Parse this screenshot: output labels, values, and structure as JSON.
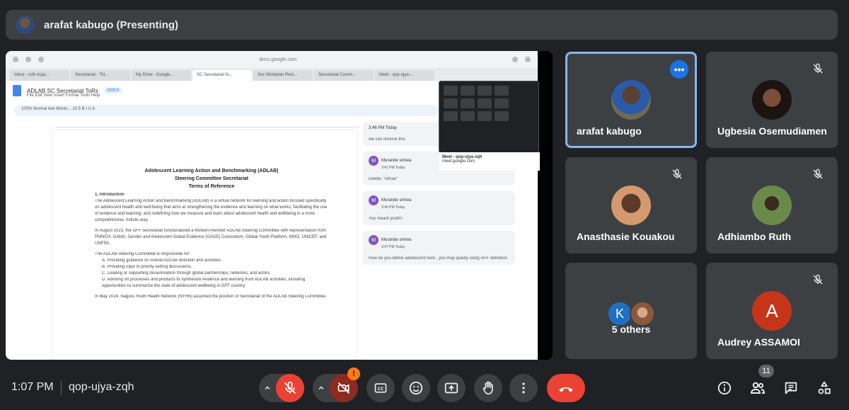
{
  "presenting": {
    "label": "arafat kabugo (Presenting)"
  },
  "screen": {
    "url": "docs.google.com",
    "tabs": [
      "Inbox - ruth.orga...",
      "Secretariat - TN...",
      "My Drive - Google...",
      "SC Secretariat fo...",
      "Sec Workplan Revi...",
      "Secretariat Comm...",
      "Meet - qop-ujya-..."
    ],
    "doc_title": "ADLAB SC Secretariat ToRs",
    "doc_badge": ".DOCX",
    "menu": "File   Edit   View   Insert   Format   Tools   Help",
    "toolbar": "100%     Normal text     Monts...     10.5     B   I   U   A",
    "doc": {
      "heading1": "Adolescent Learning Action and Benchmarking (ADLAB)",
      "heading2": "Steering Committee Secretariat",
      "heading3": "Terms of Reference",
      "section": "1.   Introduction",
      "para1": "The Adolescent Learning Action and Benchmarking (ADLAB) is a virtual network for learning and action focused specifically on adolescent health and well-being that aims at strengthening the evidence and learning on what works; facilitating the use of evidence and learning; and redefining how we measure and learn about adolescent health and wellbeing in a more comprehensive, holistic way.",
      "para2": "In August 2023, the GFF Secretariat functionalized a thirteen-member ADLAB Steering Committee with representation from PMNCH, GAMA, Gender and Adolescent Global Evidence (GAGE) Consortium, Global Youth Platform, WHO, UNICEF, and UNFPA.",
      "para3": "The ADLAB Steering Committee is responsible for:",
      "listA": "A.  Providing guidance on overall ADLAB direction and activities.",
      "listB": "B.  Providing input to priority-setting discussions.",
      "listC": "C.  Leading or supporting dissemination through global partnerships, networks, and actors.",
      "listD": "D.  Advising on processes and products to synthesize evidence and learning from ADLAB activities, including opportunities to summarize the state of adolescent wellbeing in GFF country.",
      "para4": "In May 2024, Naguru Youth Health Network (NYHN) assumed the position of Secretariat of the ADLAB Steering Committee."
    },
    "comments": [
      {
        "author": "",
        "time": "3:46 PM Today",
        "text": "we can remove this"
      },
      {
        "author": "Murande simwa",
        "time": "3:41 PM Today",
        "text": "Delete: \"virtual\""
      },
      {
        "author": "Murande simwa",
        "time": "3:46 PM Today",
        "text": "You meant youth?"
      },
      {
        "author": "Murande simwa",
        "time": "3:47 PM Today",
        "text": "How do you define adolescent here , you may qualify using GFF definition"
      }
    ],
    "mini_meet_caption": "Meet - qop-ujya-zqh",
    "mini_meet_sub": "meet.google.com"
  },
  "participants": [
    {
      "name": "arafat kabugo",
      "speaking": true
    },
    {
      "name": "Ugbesia Osemudiamen",
      "muted": true
    },
    {
      "name": "Anasthasie Kouakou",
      "muted": true
    },
    {
      "name": "Adhiambo Ruth",
      "muted": true
    },
    {
      "name": "5 others",
      "initial": "K"
    },
    {
      "name": "Audrey ASSAMOI",
      "initial": "A",
      "muted": true
    }
  ],
  "bottom": {
    "time": "1:07 PM",
    "meeting_code": "qop-ujya-zqh",
    "people_count": "11",
    "camera_warning": "!"
  },
  "colors": {
    "background": "#202124",
    "tile": "#3c4043",
    "end_call": "#ea4335",
    "accent": "#8ab4f8"
  }
}
